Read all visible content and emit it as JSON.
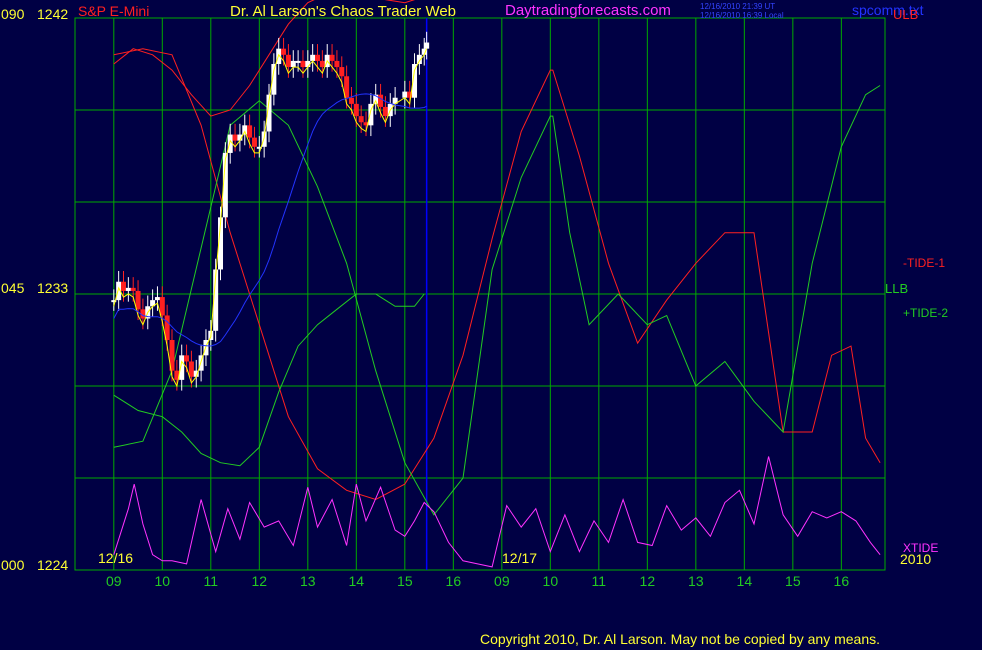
{
  "colors": {
    "background": "#000044",
    "grid": "#00aa00",
    "frame": "#0000ff",
    "red": "#ff2020",
    "green": "#22cc22",
    "magenta": "#ff33ff",
    "white": "#ffffff",
    "yellow": "#ffff00",
    "blue": "#2233ff"
  },
  "header": {
    "symbol": "S&P E-Mini",
    "title": "Dr. Al Larson's Chaos Trader Web",
    "site": "Daytradingforecasts.com",
    "time_ut": "12/16/2010 21:39 UT",
    "time_local": "12/16/2010 16:39 Local",
    "file": "spcomm.txt",
    "copyright": "Copyright 2010, Dr. Al Larson. May not be copied by any means."
  },
  "chart_data": {
    "type": "line",
    "title": "S&P E-Mini",
    "y_left_outer": [
      "090",
      "045",
      "000"
    ],
    "y_left_inner": [
      "1242",
      "1233",
      "1224"
    ],
    "ylim": [
      1224,
      1242
    ],
    "x_hours": [
      "09",
      "10",
      "11",
      "12",
      "13",
      "14",
      "15",
      "16",
      "09",
      "10",
      "11",
      "12",
      "13",
      "14",
      "15",
      "16"
    ],
    "date_labels": [
      "12/16",
      "12/17"
    ],
    "year_label": "2010",
    "series_labels": [
      "ULB",
      "-TIDE-1",
      "LLB",
      "+TIDE-2",
      "XTIDE"
    ],
    "series": [
      {
        "name": "ULB",
        "color": "red",
        "x": [
          0,
          0.4,
          0.8,
          1.2,
          1.6,
          2,
          2.4,
          2.8,
          3.2,
          3.6,
          4,
          4.4,
          4.8,
          5.2,
          5.6,
          6,
          6.2,
          6.4
        ],
        "values": [
          1240.5,
          1241,
          1240.8,
          1240.3,
          1239.5,
          1238.8,
          1239,
          1239.8,
          1240.8,
          1241.8,
          1242.5,
          1242.8,
          1242.9,
          1242.8,
          1242.6,
          1242.5,
          1242.6,
          1242.7
        ]
      },
      {
        "name": "-TIDE-1",
        "color": "red",
        "x": [
          0,
          0.6,
          1.2,
          1.8,
          2.4,
          3,
          3.6,
          4.2,
          4.8,
          5.4,
          6,
          6.6,
          7.2,
          7.8,
          8.4,
          9,
          9.05,
          9.6,
          10.2,
          10.8,
          11.4,
          12,
          12.6,
          13.2,
          13.8,
          14.4,
          14.8,
          15.2,
          15.5,
          15.8
        ],
        "values": [
          1240.8,
          1241,
          1240.8,
          1238.5,
          1235,
          1232,
          1229,
          1227.3,
          1226.6,
          1226.3,
          1226.8,
          1228.3,
          1231,
          1234.8,
          1238.3,
          1240.3,
          1240.3,
          1237.5,
          1234,
          1231.4,
          1232.8,
          1234,
          1235,
          1235,
          1228.5,
          1228.5,
          1231,
          1231.3,
          1228.3,
          1227.5
        ]
      },
      {
        "name": "LLB",
        "color": "green",
        "x": [
          0,
          0.5,
          1,
          1.4,
          1.8,
          2.2,
          2.6,
          3,
          3.4,
          3.8,
          4.2,
          4.6,
          5,
          5.4,
          5.8,
          6.2,
          6.4
        ],
        "values": [
          1229.7,
          1229.2,
          1229,
          1228.5,
          1227.8,
          1227.5,
          1227.4,
          1228,
          1229.8,
          1231.3,
          1232,
          1232.5,
          1233,
          1233,
          1232.6,
          1232.6,
          1233
        ]
      },
      {
        "name": "+TIDE-2",
        "color": "green",
        "x": [
          0,
          0.6,
          1.2,
          1.8,
          2.4,
          3,
          3.6,
          4.2,
          4.8,
          5.4,
          6,
          6.6,
          7.2,
          7.8,
          8.4,
          9,
          9.05,
          9.4,
          9.8,
          10.4,
          11,
          11.4,
          12,
          12.6,
          13.2,
          13.8,
          14.4,
          15,
          15.5,
          15.8
        ],
        "values": [
          1228,
          1228.2,
          1230.5,
          1234.5,
          1238.5,
          1239.3,
          1238.5,
          1236.5,
          1234,
          1230.5,
          1227.5,
          1225.8,
          1227,
          1233.8,
          1236.8,
          1238.8,
          1238.8,
          1235,
          1232,
          1233,
          1232,
          1232.3,
          1230,
          1230.8,
          1229.5,
          1228.5,
          1234,
          1237.8,
          1239.5,
          1239.8
        ]
      },
      {
        "name": "XTIDE",
        "color": "magenta",
        "x": [
          0,
          0.3,
          0.42,
          0.6,
          0.8,
          1,
          1.2,
          1.5,
          1.8,
          2.1,
          2.35,
          2.6,
          2.8,
          3.1,
          3.4,
          3.7,
          4,
          4.2,
          4.5,
          4.8,
          5,
          5.2,
          5.5,
          5.8,
          6,
          6.2,
          6.4,
          6.6,
          6.9,
          7.2,
          7.5,
          7.8,
          8.1,
          8.4,
          8.7,
          9,
          9.3,
          9.6,
          9.9,
          10.2,
          10.5,
          10.8,
          11.1,
          11.4,
          11.7,
          12,
          12.3,
          12.6,
          12.9,
          13.2,
          13.5,
          13.8,
          14.1,
          14.4,
          14.7,
          15,
          15.3,
          15.6,
          15.8
        ],
        "values": [
          1224.5,
          1226,
          1226.8,
          1225.5,
          1224.5,
          1224.3,
          1224.3,
          1224.2,
          1226.3,
          1224.6,
          1226,
          1225,
          1226.2,
          1225.4,
          1225.6,
          1224.8,
          1226.7,
          1225.4,
          1226.3,
          1224.8,
          1226.8,
          1225.6,
          1226.7,
          1225.3,
          1225.1,
          1225.6,
          1226.2,
          1225.9,
          1224.9,
          1224.3,
          1224.2,
          1224.1,
          1226.1,
          1225.4,
          1226,
          1224.6,
          1225.8,
          1224.6,
          1225.6,
          1224.9,
          1226.3,
          1224.9,
          1224.8,
          1226.1,
          1225.3,
          1225.7,
          1225.1,
          1226.2,
          1226.6,
          1225.5,
          1227.7,
          1225.8,
          1225.1,
          1225.9,
          1225.7,
          1225.9,
          1225.6,
          1224.9,
          1224.5
        ]
      }
    ],
    "price_bars": {
      "x": [
        0,
        0.1,
        0.2,
        0.3,
        0.4,
        0.5,
        0.6,
        0.7,
        0.8,
        0.9,
        1,
        1.1,
        1.2,
        1.3,
        1.4,
        1.5,
        1.6,
        1.7,
        1.8,
        1.9,
        2,
        2.1,
        2.2,
        2.3,
        2.4,
        2.5,
        2.6,
        2.7,
        2.8,
        2.9,
        3,
        3.1,
        3.2,
        3.3,
        3.4,
        3.5,
        3.6,
        3.7,
        3.8,
        3.9,
        4,
        4.1,
        4.2,
        4.3,
        4.4,
        4.5,
        4.6,
        4.7,
        4.8,
        4.9,
        5,
        5.1,
        5.2,
        5.3,
        5.4,
        5.5,
        5.6,
        5.7,
        5.8,
        6,
        6.1,
        6.2,
        6.3,
        6.4,
        6.45
      ],
      "values": [
        1232.8,
        1233.4,
        1233.1,
        1233.2,
        1233.1,
        1232.5,
        1232.2,
        1232.6,
        1232.8,
        1232.9,
        1232.3,
        1231.5,
        1230.5,
        1230.2,
        1231.0,
        1230.8,
        1230.3,
        1230.5,
        1231.0,
        1231.5,
        1231.8,
        1233.8,
        1235.5,
        1237.6,
        1238.2,
        1238.0,
        1238.2,
        1238.5,
        1238.1,
        1237.8,
        1237.8,
        1238.3,
        1239.5,
        1240.5,
        1241.0,
        1240.8,
        1240.4,
        1240.6,
        1240.6,
        1240.4,
        1240.6,
        1240.8,
        1240.6,
        1240.4,
        1240.8,
        1240.6,
        1240.4,
        1240.1,
        1239.4,
        1239.2,
        1238.8,
        1238.6,
        1238.5,
        1239.2,
        1239.5,
        1239.1,
        1238.8,
        1239.2,
        1239.4,
        1239.6,
        1239.4,
        1240.5,
        1240.8,
        1241.0,
        1241.2
      ]
    },
    "grid": true
  }
}
